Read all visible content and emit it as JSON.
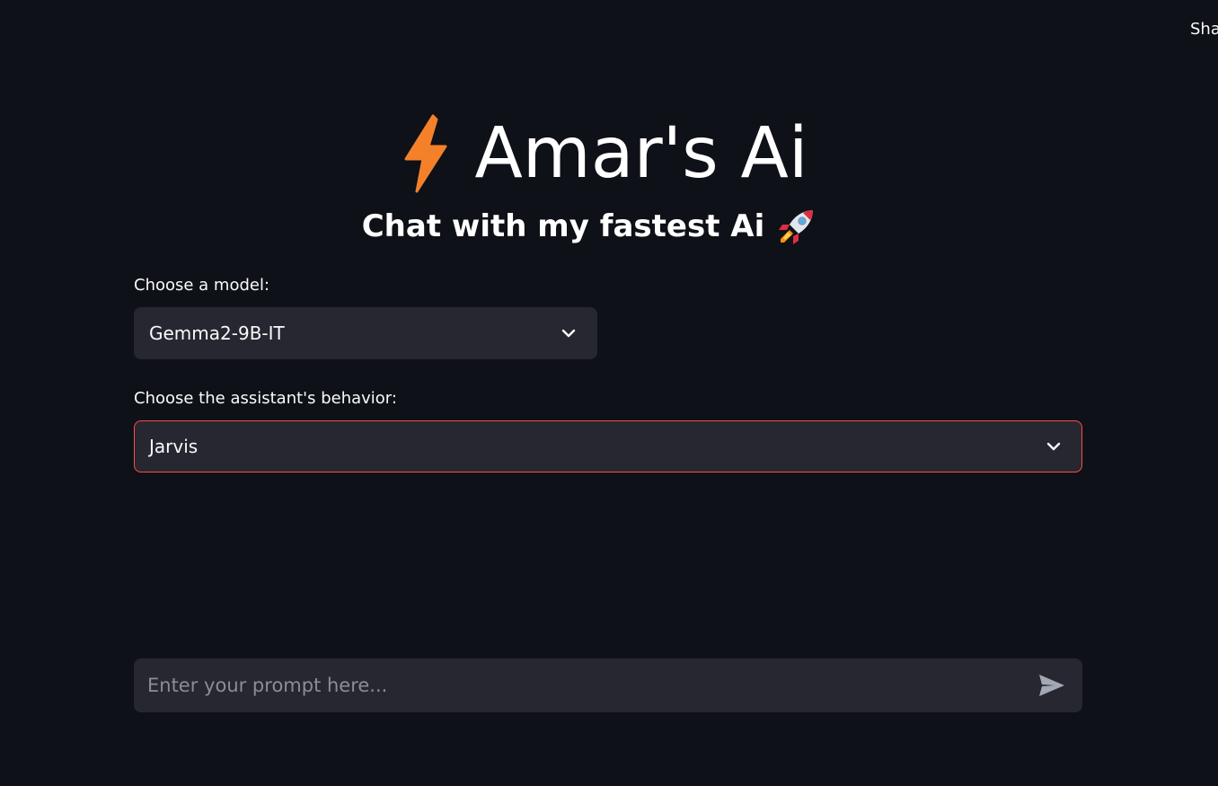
{
  "header": {
    "share_label": "Sha"
  },
  "hero": {
    "title": "Amar's Ai",
    "subtitle": "Chat with my fastest Ai",
    "title_icon": "lightning-bolt-icon",
    "subtitle_icon": "rocket-icon"
  },
  "model_select": {
    "label": "Choose a model:",
    "value": "Gemma2-9B-IT"
  },
  "behavior_select": {
    "label": "Choose the assistant's behavior:",
    "value": "Jarvis"
  },
  "chat": {
    "placeholder": "Enter your prompt here...",
    "send_icon": "send-icon"
  },
  "colors": {
    "background": "#0e1117",
    "widget": "#262730",
    "focus_border": "#ff4b4b",
    "bolt": "#f4812a"
  }
}
